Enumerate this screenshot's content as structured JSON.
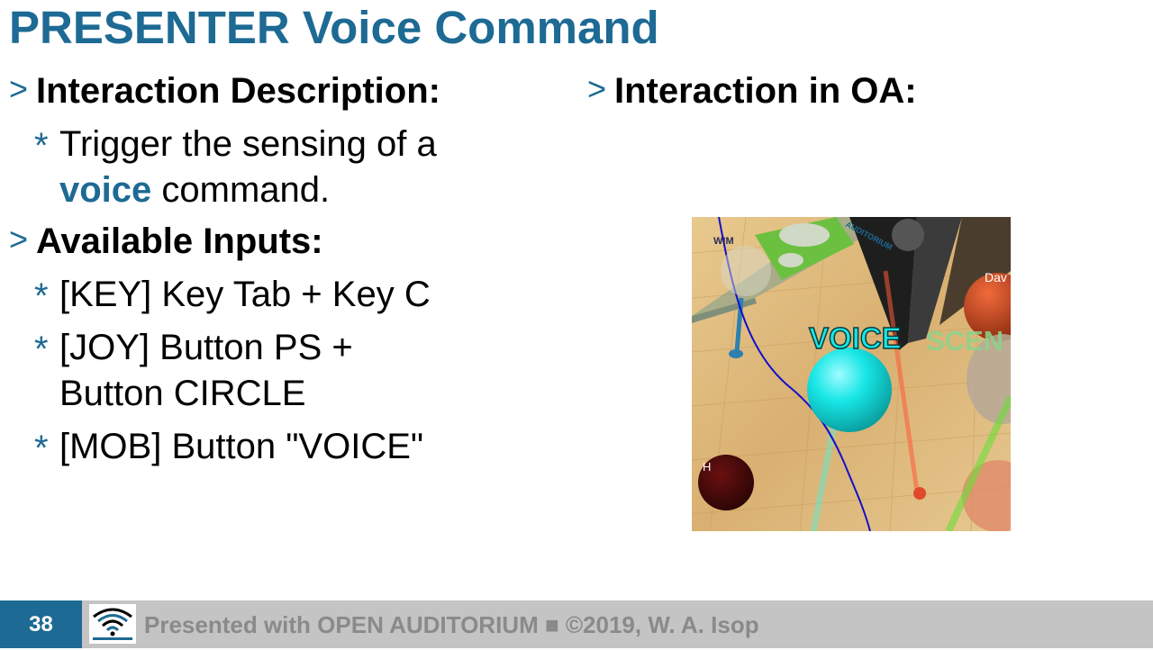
{
  "slide": {
    "title": "PRESENTER Voice Command",
    "bullet_marker": ">",
    "sub_marker": "*"
  },
  "left": {
    "heading1": "Interaction Description:",
    "desc_part1": "Trigger the sensing of a",
    "desc_highlight": "voice",
    "desc_part2": " command.",
    "heading2": "Available Inputs:",
    "inputs": [
      "[KEY] Key Tab + Key C",
      "[JOY] Button PS + Button CIRCLE",
      "[MOB] Button \"VOICE\""
    ]
  },
  "right": {
    "heading": "Interaction in OA:",
    "screenshot_labels": {
      "voice": "VOICE",
      "scene": "SCEN",
      "wim": "WIM",
      "dav": "Dav",
      "hc": "H",
      "auditorium": "AUDITORIUM"
    }
  },
  "footer": {
    "page_number": "38",
    "text": "Presented with OPEN AUDITORIUM ■ ©2019, W. A. Isop",
    "logo_icon": "open-auditorium-logo-icon"
  },
  "colors": {
    "accent": "#1d6a94",
    "footer_bg": "#c4c4c4",
    "footer_text": "#8a8a8a"
  }
}
